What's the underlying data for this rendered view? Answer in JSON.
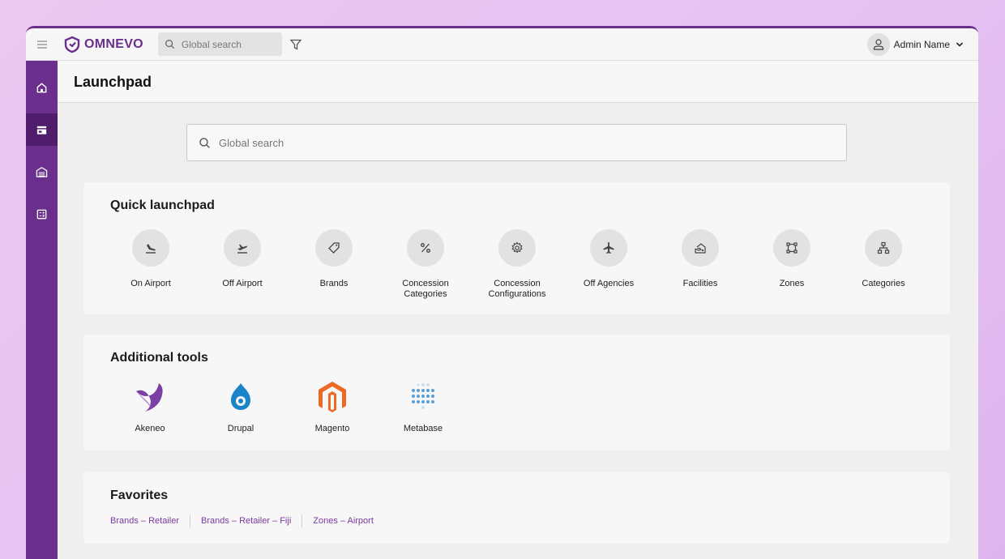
{
  "app": {
    "brand": "OMNEVO",
    "brand_color": "#6a2f8c"
  },
  "topbar": {
    "search_placeholder": "Global search",
    "user_name": "Admin Name"
  },
  "sidebar": {
    "items": [
      {
        "name": "home",
        "icon": "home-icon"
      },
      {
        "name": "store",
        "icon": "store-icon"
      },
      {
        "name": "warehouse",
        "icon": "warehouse-icon"
      },
      {
        "name": "calculator",
        "icon": "calculator-icon"
      }
    ],
    "active_index": 1
  },
  "page": {
    "title": "Launchpad"
  },
  "main_search": {
    "placeholder": "Global search"
  },
  "quick_launchpad": {
    "title": "Quick launchpad",
    "items": [
      {
        "label": "On Airport",
        "icon": "plane-landing-icon"
      },
      {
        "label": "Off Airport",
        "icon": "plane-takeoff-icon"
      },
      {
        "label": "Brands",
        "icon": "tag-icon"
      },
      {
        "label": "Concession Categories",
        "icon": "percent-icon"
      },
      {
        "label": "Concession Configurations",
        "icon": "gear-icon"
      },
      {
        "label": "Off Agencies",
        "icon": "airplane-icon"
      },
      {
        "label": "Facilities",
        "icon": "facility-icon"
      },
      {
        "label": "Zones",
        "icon": "zones-icon"
      },
      {
        "label": "Categories",
        "icon": "hierarchy-icon"
      }
    ]
  },
  "additional_tools": {
    "title": "Additional tools",
    "items": [
      {
        "label": "Akeneo",
        "icon": "akeneo-logo"
      },
      {
        "label": "Drupal",
        "icon": "drupal-logo"
      },
      {
        "label": "Magento",
        "icon": "magento-logo"
      },
      {
        "label": "Metabase",
        "icon": "metabase-logo"
      }
    ]
  },
  "favorites": {
    "title": "Favorites",
    "items": [
      "Brands – Retailer",
      "Brands – Retailer – Fiji",
      "Zones – Airport"
    ]
  }
}
